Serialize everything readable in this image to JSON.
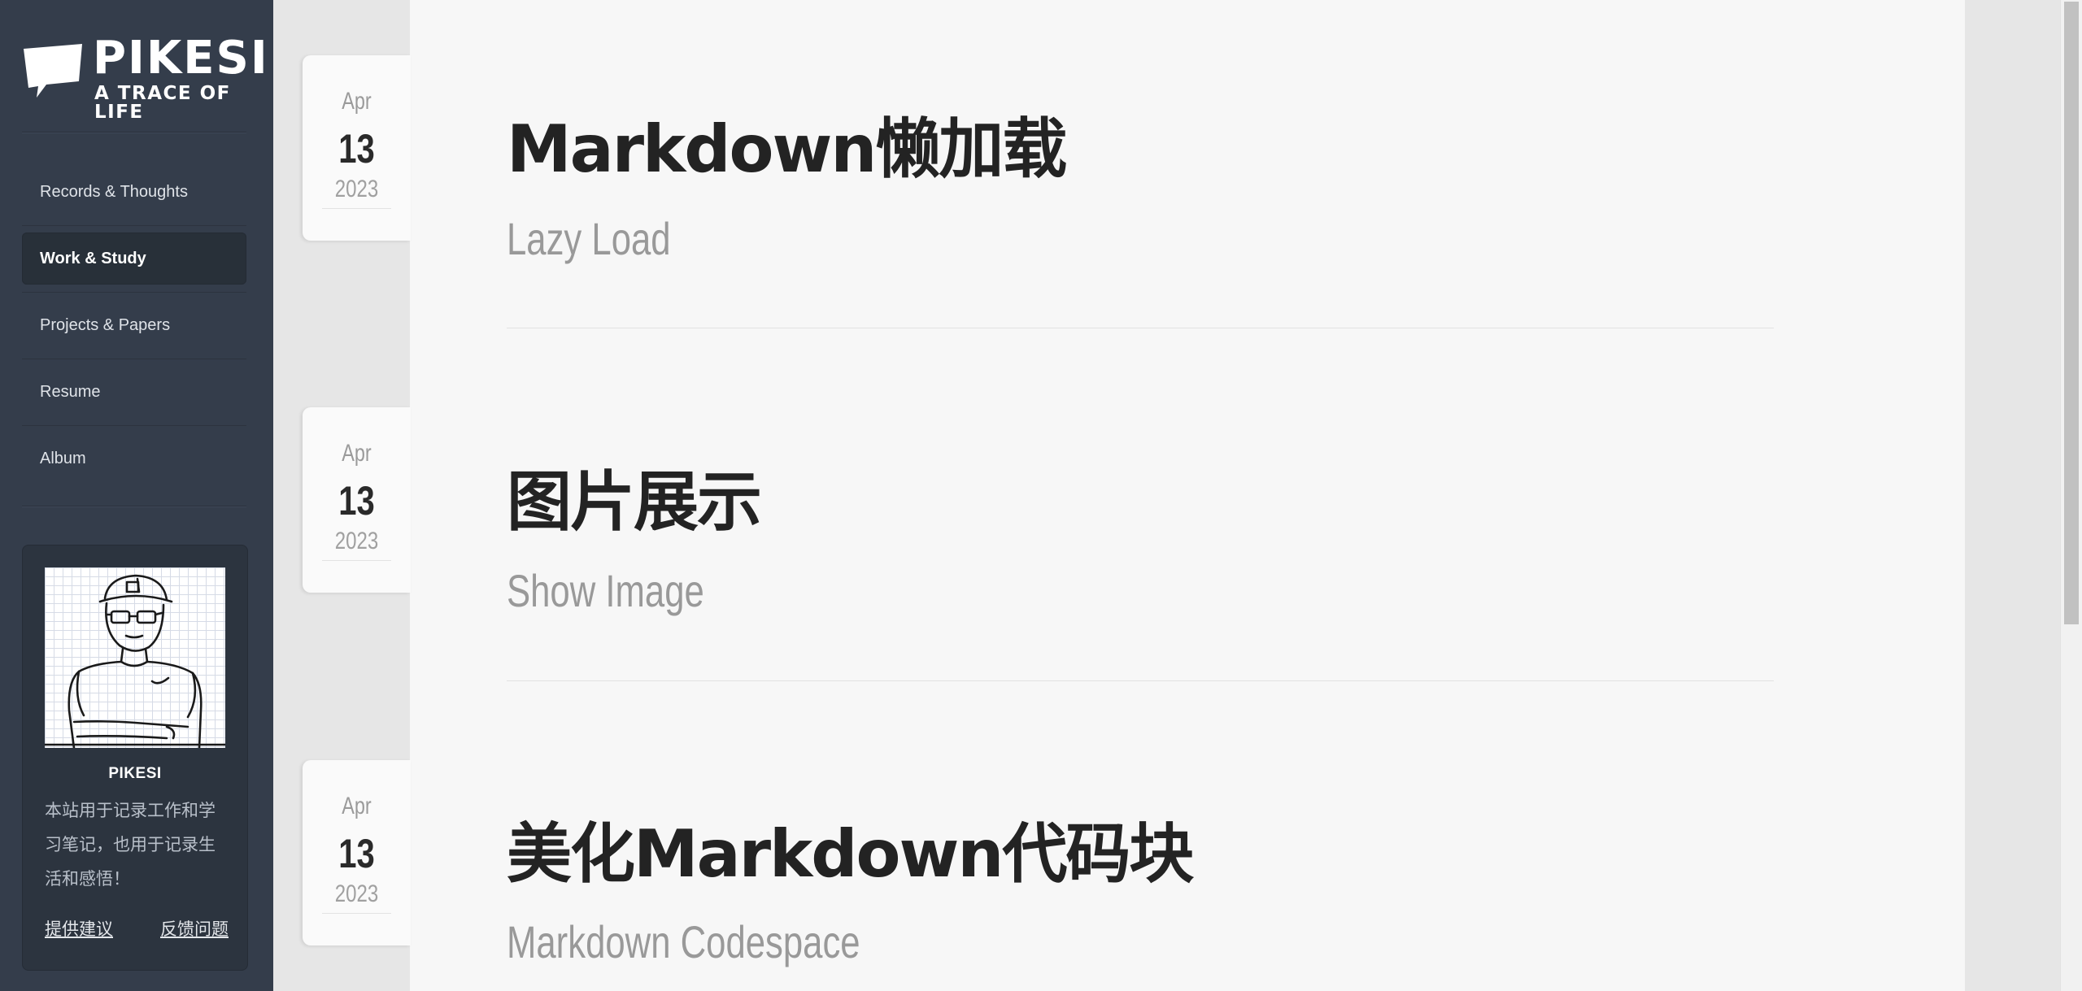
{
  "site": {
    "name": "PIKESI",
    "tagline": "A TRACE OF LIFE"
  },
  "nav": {
    "items": [
      {
        "label": "Records & Thoughts",
        "active": false
      },
      {
        "label": "Work & Study",
        "active": true
      },
      {
        "label": "Projects & Papers",
        "active": false
      },
      {
        "label": "Resume",
        "active": false
      },
      {
        "label": "Album",
        "active": false
      }
    ]
  },
  "profile": {
    "name": "PIKESI",
    "description": "本站用于记录工作和学习笔记，也用于记录生活和感悟！",
    "links": {
      "suggest": "提供建议",
      "feedback": "反馈问题"
    }
  },
  "posts": [
    {
      "month": "Apr",
      "day": "13",
      "year": "2023",
      "title": "Markdown懒加载",
      "subtitle": "Lazy Load"
    },
    {
      "month": "Apr",
      "day": "13",
      "year": "2023",
      "title": "图片展示",
      "subtitle": "Show Image"
    },
    {
      "month": "Apr",
      "day": "13",
      "year": "2023",
      "title": "美化Markdown代码块",
      "subtitle": "Markdown Codespace"
    }
  ],
  "colors": {
    "sidebar_bg": "#343d4b",
    "active_nav_bg": "#283039",
    "content_bg": "#f7f7f7",
    "title_text": "#232323",
    "subtitle_text": "#999999"
  }
}
